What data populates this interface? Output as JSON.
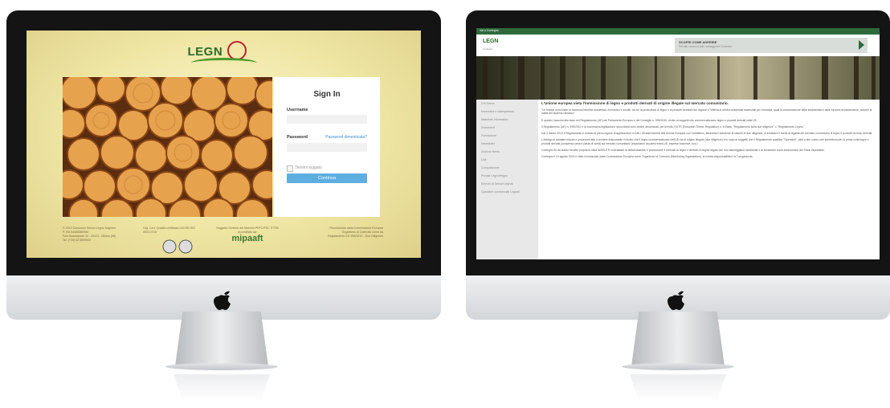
{
  "left_screen": {
    "logo_text": "LEGN",
    "login": {
      "title": "Sign In",
      "username_label": "Username",
      "password_label": "Password",
      "forgot_link": "Password dimenticata?",
      "remember_label": "Tienimi loggato",
      "submit_label": "Continua"
    },
    "footer": {
      "col1": [
        "© 2013 Consorzio Servizi Legno Sughero",
        "P. IVA 04365560960",
        "Foro Buonaparte 12 - 20121 - Milano (MI)",
        "Tel. (+39) 02 8909000"
      ],
      "col2": [
        "Org. Cert. Qualità certificato UNI EN ISO 9001:2015"
      ],
      "col3": [
        "Soggetto Gestore del Marchio PEFC/FSC ITTSB",
        "Accreditato da:"
      ],
      "col4": [
        "Riconosciuto dalla Commissione Europea",
        "Organismo di Controllo come da",
        "Regolamento EU 995/2010 - Due Diligence"
      ],
      "mipaaft_label": "mipaaft"
    }
  },
  "right_screen": {
    "topbar_text": "Vai a Conlegno",
    "logo_text": "LEGN",
    "logo_sub": "conlegno",
    "banner_title": "SCOPRI COME ADERIRE",
    "banner_sub": "Per tutti i servizi e tutti i vantaggi del Consorzio",
    "sidebar": [
      "Chi Siamo",
      "Normativa e adempimenti",
      "Materiale Informativo",
      "Documenti",
      "Formazione",
      "Newsletter",
      "Archivio News",
      "Link",
      "Composizione",
      "Portale Legnoelegno",
      "Elenchi di Servizi Legnali",
      "Operatori commerciali Legnali"
    ],
    "heading": "L'Unione europea vieta l'immissione di legno e prodotti derivati di origine illegale sul mercato comunitario.",
    "paragraphs": [
      "\"Le foreste sono fonte di numerosi benefici ambientali, economici e sociali, tra cui la produzione di legno e di prodotti forestali non legnosi e l'offerta di servizi ambientali essenziali per l'umanità, quali la conservazione della biodiversità e delle funzioni ecosistemiche, nonché la tutela del sistema climatico\".",
      "È questo l'assunto alla base del Regolamento (UE) del Parlamento Europeo e del Consiglio n. 995/2010, rivolto ai soggetti che commercializzano legno e prodotti derivati nella UE.",
      "Il Regolamento (UE) n. 995/2010 e la successiva legislazione secondaria sono anche denominati, per brevità, EUTR (European Timber Regulation) o, in Italia, \"Regolamento sulla due diligence\" o \"Regolamento Legno\".",
      "Dal 3 marzo 2013 il Regolamento è entrato in pieno regime di applicazione in tutti i 28 stati membri dell'Unione Europea con l'obbiettivo, attraverso l'adozione di sistemi di due diligence, di innalzare il livello di legalità del mercato comunitario di legno e prodotti da esso derivati.",
      "L'obbligo di adottare misure e procedure atte a rendere trascurabile il rischio che il legno commercializzato nell'UE sia di origine illegale (due diligence) è in capo ai soggetti che il Regolamento qualifica \"Operatori\", vale a dire coloro che immettono per la prima volta legno e prodotti derivati (compresa carta e pasta di carta) sul mercato comunitario (importatori da paesi extra-UE, imprese boschive, ecc.).",
      "Conlegno fin da subito ha fatto propria la sfida dell'EUTR contrastare la deforestazione e promuovere il mercato di legno e derivati di origine legale che non danneggiano l'ambiente e le condizioni socio-economiche dei Paesi esportatori.",
      "Conlegno il 19 agosto 2013 è stato riconosciuto dalla Commissione Europea come Organismo di Controllo (Monitoring Organisation): la nostra responsabilità è la Tua garanzia."
    ]
  }
}
